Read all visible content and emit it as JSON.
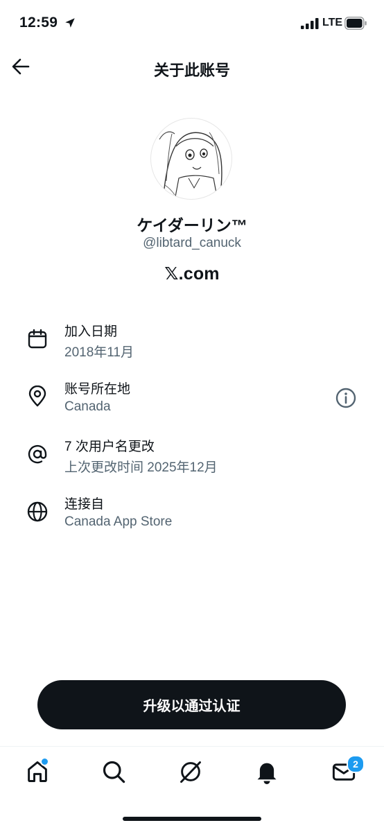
{
  "status_bar": {
    "time": "12:59",
    "network": "LTE"
  },
  "header": {
    "title": "关于此账号"
  },
  "profile": {
    "display_name": "ケイダーリン™",
    "handle": "@libtard_canuck",
    "brand": "𝕏.com"
  },
  "info_rows": [
    {
      "icon": "calendar-icon",
      "title": "加入日期",
      "value": "2018年11月"
    },
    {
      "icon": "location-pin-icon",
      "title": "账号所在地",
      "value": "Canada"
    },
    {
      "icon": "at-sign-icon",
      "title": "7 次用户名更改",
      "value": "上次更改时间 2025年12月"
    },
    {
      "icon": "globe-icon",
      "title": "连接自",
      "value": "Canada App Store"
    }
  ],
  "cta": {
    "label": "升级以通过认证"
  },
  "tabbar": {
    "messages_badge": "2",
    "tabs": [
      "home-icon",
      "search-icon",
      "grok-icon",
      "bell-icon",
      "mail-icon"
    ]
  },
  "colors": {
    "text": "#0f1419",
    "secondary": "#536471",
    "accent": "#1d9bf0"
  }
}
